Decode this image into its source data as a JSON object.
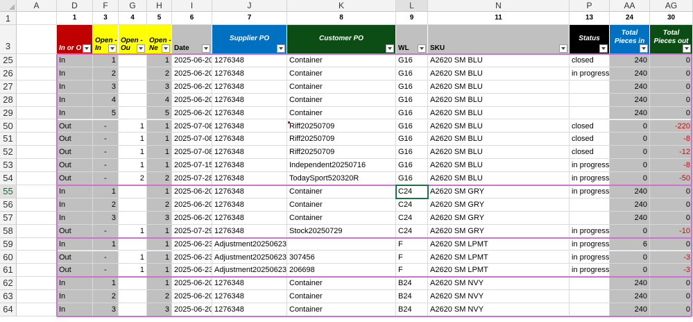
{
  "columns": [
    "A",
    "D",
    "F",
    "G",
    "H",
    "I",
    "J",
    "K",
    "L",
    "N",
    "P",
    "AA",
    "AG"
  ],
  "selected_column": "L",
  "row1_numbers": [
    "",
    "1",
    "3",
    "4",
    "5",
    "6",
    "7",
    "8",
    "9",
    "11",
    "13",
    "24",
    "30"
  ],
  "headers": {
    "D": "In or O",
    "F": "Open - In",
    "G": "Open - Ou",
    "H": "Open - Ne",
    "I": "Date",
    "J": "Supplier PO",
    "K": "Customer PO",
    "L": "WL",
    "N": "SKU",
    "P": "Status",
    "AA": "Total Pieces in",
    "AG": "Total Pieces out"
  },
  "header_colors": {
    "D": "#c00000",
    "F": "#ffff00",
    "G": "#ffff00",
    "H": "#ffff00",
    "I": "#bfbfbf",
    "J": "#0070c0",
    "K": "#0b4d14",
    "L": "#c0c0c0",
    "N": "#c0c0c0",
    "P": "#000000",
    "AA": "#0070c0",
    "AG": "#0b4d14"
  },
  "selected_row": "55",
  "rows": [
    {
      "r": "25",
      "D": "In",
      "F": "1",
      "G": "",
      "H": "1",
      "I": "2025-06-20",
      "J": "1276348",
      "K": "Container",
      "L": "G16",
      "N": "A2620 SM BLU",
      "P": "closed",
      "AA": "240",
      "AG": "0"
    },
    {
      "r": "26",
      "D": "In",
      "F": "2",
      "G": "",
      "H": "2",
      "I": "2025-06-20",
      "J": "1276348",
      "K": "Container",
      "L": "G16",
      "N": "A2620 SM BLU",
      "P": "in progress",
      "AA": "240",
      "AG": "0"
    },
    {
      "r": "27",
      "D": "In",
      "F": "3",
      "G": "",
      "H": "3",
      "I": "2025-06-20",
      "J": "1276348",
      "K": "Container",
      "L": "G16",
      "N": "A2620 SM BLU",
      "P": "",
      "AA": "240",
      "AG": "0"
    },
    {
      "r": "28",
      "D": "In",
      "F": "4",
      "G": "",
      "H": "4",
      "I": "2025-06-20",
      "J": "1276348",
      "K": "Container",
      "L": "G16",
      "N": "A2620 SM BLU",
      "P": "",
      "AA": "240",
      "AG": "0"
    },
    {
      "r": "29",
      "D": "In",
      "F": "5",
      "G": "",
      "H": "5",
      "I": "2025-06-20",
      "J": "1276348",
      "K": "Container",
      "L": "G16",
      "N": "A2620 SM BLU",
      "P": "",
      "AA": "240",
      "AG": "0"
    },
    {
      "r": "50",
      "D": "Out",
      "F": "-",
      "G": "1",
      "H": "1",
      "I": "2025-07-08",
      "J": "1276348",
      "K": "Riff20250709",
      "L": "G16",
      "N": "A2620 SM BLU",
      "P": "closed",
      "AA": "0",
      "AG": "-220"
    },
    {
      "r": "51",
      "D": "Out",
      "F": "-",
      "G": "1",
      "H": "1",
      "I": "2025-07-08",
      "J": "1276348",
      "K": "Riff20250709",
      "L": "G16",
      "N": "A2620 SM BLU",
      "P": "closed",
      "AA": "0",
      "AG": "-8"
    },
    {
      "r": "52",
      "D": "Out",
      "F": "-",
      "G": "1",
      "H": "1",
      "I": "2025-07-08",
      "J": "1276348",
      "K": "Riff20250709",
      "L": "G16",
      "N": "A2620 SM BLU",
      "P": "closed",
      "AA": "0",
      "AG": "-12"
    },
    {
      "r": "53",
      "D": "Out",
      "F": "-",
      "G": "1",
      "H": "1",
      "I": "2025-07-15",
      "J": "1276348",
      "K": "Independent20250716",
      "L": "G16",
      "N": "A2620 SM BLU",
      "P": "in progress",
      "AA": "0",
      "AG": "-8"
    },
    {
      "r": "54",
      "D": "Out",
      "F": "-",
      "G": "2",
      "H": "2",
      "I": "2025-07-28",
      "J": "1276348",
      "K": "TodaySport520320R",
      "L": "G16",
      "N": "A2620 SM BLU",
      "P": "in progress",
      "AA": "0",
      "AG": "-50"
    },
    {
      "r": "55",
      "D": "In",
      "F": "1",
      "G": "",
      "H": "1",
      "I": "2025-06-20",
      "J": "1276348",
      "K": "Container",
      "L": "C24",
      "N": "A2620 SM GRY",
      "P": "in progress",
      "AA": "240",
      "AG": "0"
    },
    {
      "r": "56",
      "D": "In",
      "F": "2",
      "G": "",
      "H": "2",
      "I": "2025-06-20",
      "J": "1276348",
      "K": "Container",
      "L": "C24",
      "N": "A2620 SM GRY",
      "P": "",
      "AA": "240",
      "AG": "0"
    },
    {
      "r": "57",
      "D": "In",
      "F": "3",
      "G": "",
      "H": "3",
      "I": "2025-06-20",
      "J": "1276348",
      "K": "Container",
      "L": "C24",
      "N": "A2620 SM GRY",
      "P": "",
      "AA": "240",
      "AG": "0"
    },
    {
      "r": "58",
      "D": "Out",
      "F": "-",
      "G": "1",
      "H": "1",
      "I": "2025-07-29",
      "J": "1276348",
      "K": "Stock20250729",
      "L": "C24",
      "N": "A2620 SM GRY",
      "P": "in progress",
      "AA": "0",
      "AG": "-10"
    },
    {
      "r": "59",
      "D": "In",
      "F": "1",
      "G": "",
      "H": "1",
      "I": "2025-06-23",
      "J": "Adjustment20250623",
      "K": "",
      "L": "F",
      "N": "A2620 SM LPMT",
      "P": "in progress",
      "AA": "6",
      "AG": "0"
    },
    {
      "r": "60",
      "D": "Out",
      "F": "-",
      "G": "1",
      "H": "1",
      "I": "2025-06-23",
      "J": "Adjustment20250623",
      "K": "307456",
      "L": "F",
      "N": "A2620 SM LPMT",
      "P": "in progress",
      "AA": "0",
      "AG": "-3"
    },
    {
      "r": "61",
      "D": "Out",
      "F": "-",
      "G": "1",
      "H": "1",
      "I": "2025-06-23",
      "J": "Adjustment20250623",
      "K": "206698",
      "L": "F",
      "N": "A2620 SM LPMT",
      "P": "in progress",
      "AA": "0",
      "AG": "-3"
    },
    {
      "r": "62",
      "D": "In",
      "F": "1",
      "G": "",
      "H": "1",
      "I": "2025-06-20",
      "J": "1276348",
      "K": "Container",
      "L": "B24",
      "N": "A2620 SM NVY",
      "P": "",
      "AA": "240",
      "AG": "0"
    },
    {
      "r": "63",
      "D": "In",
      "F": "2",
      "G": "",
      "H": "2",
      "I": "2025-06-20",
      "J": "1276348",
      "K": "Container",
      "L": "B24",
      "N": "A2620 SM NVY",
      "P": "",
      "AA": "240",
      "AG": "0"
    },
    {
      "r": "64",
      "D": "In",
      "F": "3",
      "G": "",
      "H": "3",
      "I": "2025-06-20",
      "J": "1276348",
      "K": "Container",
      "L": "B24",
      "N": "A2620 SM NVY",
      "P": "",
      "AA": "240",
      "AG": "0"
    }
  ]
}
